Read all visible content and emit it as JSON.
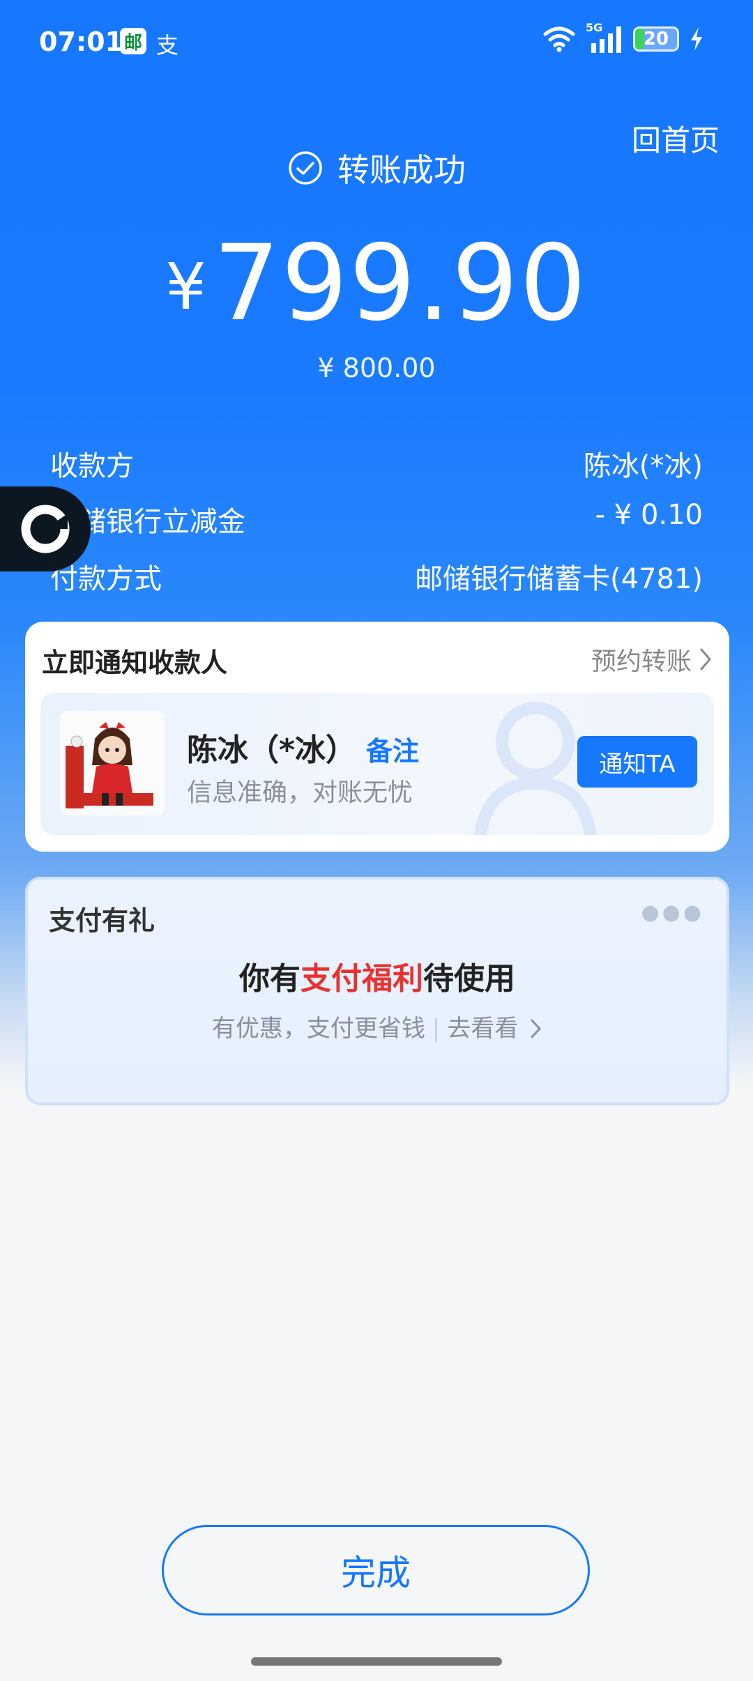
{
  "status_bar": {
    "time": "07:01",
    "app_icon_glyph": "邮",
    "pay_icon_glyph": "支",
    "network": "5G",
    "battery": "20",
    "battery_level": 0.2
  },
  "header": {
    "home_link": "回首页",
    "success_text": "转账成功"
  },
  "amount": {
    "currency": "¥",
    "value": "799.90",
    "original": "¥ 800.00"
  },
  "details": [
    {
      "label": "收款方",
      "value": "陈冰(*冰)"
    },
    {
      "label": "邮储银行立减金",
      "value": "- ¥ 0.10"
    },
    {
      "label": "付款方式",
      "value": "邮储银行储蓄卡(4781)"
    }
  ],
  "notify_card": {
    "title": "立即通知收款人",
    "link": "预约转账",
    "payee_name": "陈冰（*冰）",
    "remark": "备注",
    "subtitle": "信息准确，对账无忧",
    "button": "通知TA"
  },
  "gift_card": {
    "title": "支付有礼",
    "main_prefix": "你有",
    "main_highlight": "支付福利",
    "main_suffix": "待使用",
    "sub_text": "有优惠，支付更省钱",
    "sub_link": "去看看"
  },
  "footer": {
    "done_button": "完成"
  },
  "colors": {
    "primary": "#1677ff",
    "highlight_red": "#e8322f"
  }
}
